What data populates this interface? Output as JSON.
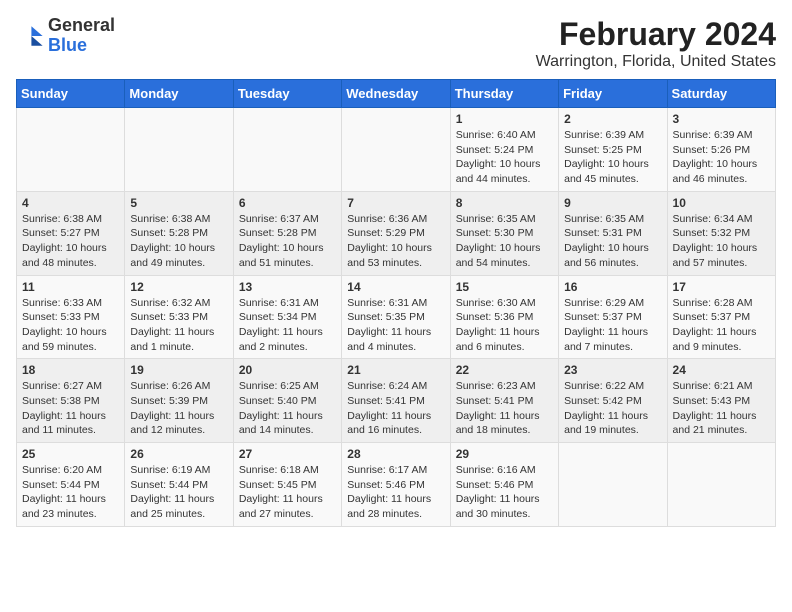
{
  "app": {
    "logo_general": "General",
    "logo_blue": "Blue",
    "title": "February 2024",
    "subtitle": "Warrington, Florida, United States"
  },
  "calendar": {
    "headers": [
      "Sunday",
      "Monday",
      "Tuesday",
      "Wednesday",
      "Thursday",
      "Friday",
      "Saturday"
    ],
    "weeks": [
      [
        {
          "day": "",
          "info": ""
        },
        {
          "day": "",
          "info": ""
        },
        {
          "day": "",
          "info": ""
        },
        {
          "day": "",
          "info": ""
        },
        {
          "day": "1",
          "info": "Sunrise: 6:40 AM\nSunset: 5:24 PM\nDaylight: 10 hours\nand 44 minutes."
        },
        {
          "day": "2",
          "info": "Sunrise: 6:39 AM\nSunset: 5:25 PM\nDaylight: 10 hours\nand 45 minutes."
        },
        {
          "day": "3",
          "info": "Sunrise: 6:39 AM\nSunset: 5:26 PM\nDaylight: 10 hours\nand 46 minutes."
        }
      ],
      [
        {
          "day": "4",
          "info": "Sunrise: 6:38 AM\nSunset: 5:27 PM\nDaylight: 10 hours\nand 48 minutes."
        },
        {
          "day": "5",
          "info": "Sunrise: 6:38 AM\nSunset: 5:28 PM\nDaylight: 10 hours\nand 49 minutes."
        },
        {
          "day": "6",
          "info": "Sunrise: 6:37 AM\nSunset: 5:28 PM\nDaylight: 10 hours\nand 51 minutes."
        },
        {
          "day": "7",
          "info": "Sunrise: 6:36 AM\nSunset: 5:29 PM\nDaylight: 10 hours\nand 53 minutes."
        },
        {
          "day": "8",
          "info": "Sunrise: 6:35 AM\nSunset: 5:30 PM\nDaylight: 10 hours\nand 54 minutes."
        },
        {
          "day": "9",
          "info": "Sunrise: 6:35 AM\nSunset: 5:31 PM\nDaylight: 10 hours\nand 56 minutes."
        },
        {
          "day": "10",
          "info": "Sunrise: 6:34 AM\nSunset: 5:32 PM\nDaylight: 10 hours\nand 57 minutes."
        }
      ],
      [
        {
          "day": "11",
          "info": "Sunrise: 6:33 AM\nSunset: 5:33 PM\nDaylight: 10 hours\nand 59 minutes."
        },
        {
          "day": "12",
          "info": "Sunrise: 6:32 AM\nSunset: 5:33 PM\nDaylight: 11 hours\nand 1 minute."
        },
        {
          "day": "13",
          "info": "Sunrise: 6:31 AM\nSunset: 5:34 PM\nDaylight: 11 hours\nand 2 minutes."
        },
        {
          "day": "14",
          "info": "Sunrise: 6:31 AM\nSunset: 5:35 PM\nDaylight: 11 hours\nand 4 minutes."
        },
        {
          "day": "15",
          "info": "Sunrise: 6:30 AM\nSunset: 5:36 PM\nDaylight: 11 hours\nand 6 minutes."
        },
        {
          "day": "16",
          "info": "Sunrise: 6:29 AM\nSunset: 5:37 PM\nDaylight: 11 hours\nand 7 minutes."
        },
        {
          "day": "17",
          "info": "Sunrise: 6:28 AM\nSunset: 5:37 PM\nDaylight: 11 hours\nand 9 minutes."
        }
      ],
      [
        {
          "day": "18",
          "info": "Sunrise: 6:27 AM\nSunset: 5:38 PM\nDaylight: 11 hours\nand 11 minutes."
        },
        {
          "day": "19",
          "info": "Sunrise: 6:26 AM\nSunset: 5:39 PM\nDaylight: 11 hours\nand 12 minutes."
        },
        {
          "day": "20",
          "info": "Sunrise: 6:25 AM\nSunset: 5:40 PM\nDaylight: 11 hours\nand 14 minutes."
        },
        {
          "day": "21",
          "info": "Sunrise: 6:24 AM\nSunset: 5:41 PM\nDaylight: 11 hours\nand 16 minutes."
        },
        {
          "day": "22",
          "info": "Sunrise: 6:23 AM\nSunset: 5:41 PM\nDaylight: 11 hours\nand 18 minutes."
        },
        {
          "day": "23",
          "info": "Sunrise: 6:22 AM\nSunset: 5:42 PM\nDaylight: 11 hours\nand 19 minutes."
        },
        {
          "day": "24",
          "info": "Sunrise: 6:21 AM\nSunset: 5:43 PM\nDaylight: 11 hours\nand 21 minutes."
        }
      ],
      [
        {
          "day": "25",
          "info": "Sunrise: 6:20 AM\nSunset: 5:44 PM\nDaylight: 11 hours\nand 23 minutes."
        },
        {
          "day": "26",
          "info": "Sunrise: 6:19 AM\nSunset: 5:44 PM\nDaylight: 11 hours\nand 25 minutes."
        },
        {
          "day": "27",
          "info": "Sunrise: 6:18 AM\nSunset: 5:45 PM\nDaylight: 11 hours\nand 27 minutes."
        },
        {
          "day": "28",
          "info": "Sunrise: 6:17 AM\nSunset: 5:46 PM\nDaylight: 11 hours\nand 28 minutes."
        },
        {
          "day": "29",
          "info": "Sunrise: 6:16 AM\nSunset: 5:46 PM\nDaylight: 11 hours\nand 30 minutes."
        },
        {
          "day": "",
          "info": ""
        },
        {
          "day": "",
          "info": ""
        }
      ]
    ]
  }
}
